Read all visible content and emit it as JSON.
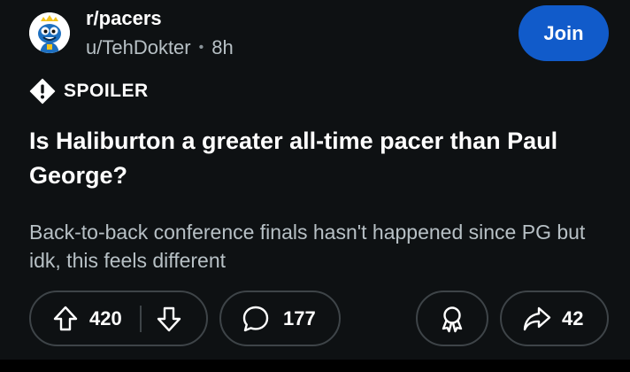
{
  "post": {
    "subreddit": "r/pacers",
    "author": "u/TehDokter",
    "separator": "•",
    "age": "8h",
    "join_label": "Join",
    "flair": "SPOILER",
    "title": "Is Haliburton a greater all-time pacer than Paul George?",
    "body": "Back-to-back conference finals hasn't happened since PG but idk, this feels different"
  },
  "actions": {
    "score": "420",
    "comments": "177",
    "shares": "42"
  },
  "colors": {
    "background": "#0e1113",
    "join_button": "#115bca",
    "secondary_text": "#b7c0c5",
    "pill_border": "#3e4448"
  },
  "icons": {
    "avatar": "subreddit-avatar-icon",
    "spoiler": "exclamation-diamond-icon",
    "upvote": "arrow-up-icon",
    "downvote": "arrow-down-icon",
    "comments": "speech-bubble-icon",
    "award": "award-ribbon-icon",
    "share": "share-arrow-icon"
  }
}
